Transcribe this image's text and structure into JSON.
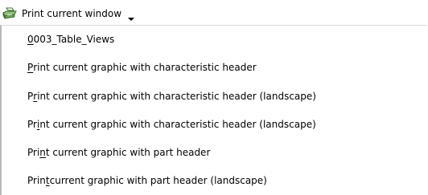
{
  "toolbar": {
    "print_button_label": "Print current window",
    "icon": "printer-icon",
    "arrow_icon": "chevron-down-icon"
  },
  "menu": {
    "items": [
      {
        "pre": "",
        "u": "0",
        "post": "003_Table_Views"
      },
      {
        "pre": "",
        "u": "P",
        "post": "rint current graphic with characteristic header"
      },
      {
        "pre": "P",
        "u": "r",
        "post": "int current graphic with characteristic header (landscape)"
      },
      {
        "pre": "Pr",
        "u": "i",
        "post": "nt current graphic with characteristic header (landscape)"
      },
      {
        "pre": "Pri",
        "u": "n",
        "post": "t current graphic with part header"
      },
      {
        "pre": "Prin",
        "u": "t",
        "post": " current graphic with part header (landscape)"
      }
    ]
  }
}
